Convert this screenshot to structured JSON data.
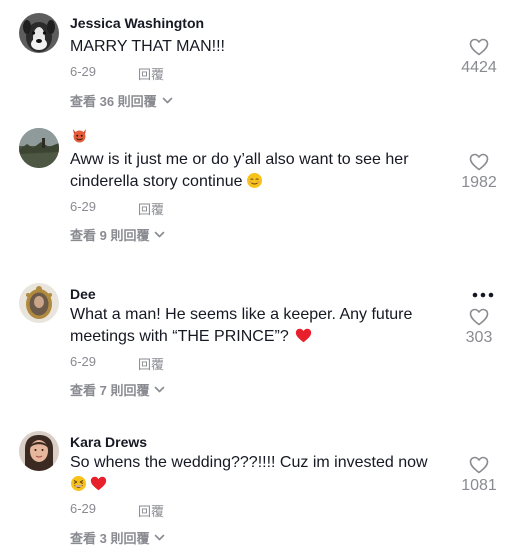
{
  "comments": [
    {
      "username": "Jessica Washington",
      "text": "MARRY THAT MAN!!!",
      "date": "6-29",
      "reply": "回覆",
      "view_replies": "查看 36 則回覆",
      "likes": "4424",
      "avatar_icon": "dog-avatar"
    },
    {
      "username": "",
      "name_icon": "devil-face-emoji",
      "text_line1": "Aww is it just me or do y’all also want to see her",
      "text_line2": "cinderella story continue",
      "text_emoji": "relieved-face-emoji",
      "date": "6-29",
      "reply": "回覆",
      "view_replies": "查看 9 則回覆",
      "likes": "1982",
      "avatar_icon": "landscape-avatar"
    },
    {
      "username": "Dee",
      "text_line1": "What a man! He seems like a keeper. Any future",
      "text_line2": "meetings with “THE PRINCE”?",
      "text_emoji": "red-heart-emoji",
      "date": "6-29",
      "reply": "回覆",
      "view_replies": "查看 7 則回覆",
      "likes": "303",
      "avatar_icon": "mirror-avatar"
    },
    {
      "username": "Kara Drews",
      "text_line1": "So whens the wedding???!!!! Cuz im invested now",
      "text_emojis": [
        "grinning-squinting-face-emoji",
        "red-heart-emoji"
      ],
      "date": "6-29",
      "reply": "回覆",
      "view_replies": "查看 3 則回覆",
      "likes": "1081",
      "avatar_icon": "woman-avatar"
    }
  ],
  "colors": {
    "text": "#161823",
    "muted": "#8a8b91",
    "heart_red": "#e8202c",
    "emoji_yellow": "#f7c21a"
  }
}
